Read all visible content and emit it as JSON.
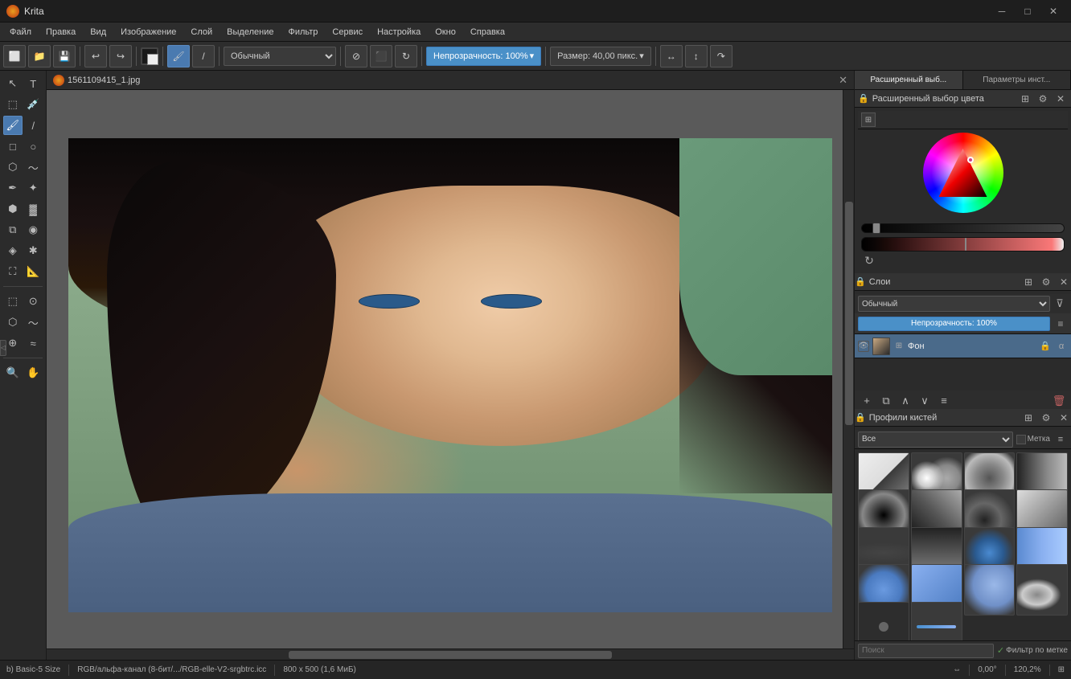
{
  "titlebar": {
    "app_name": "Krita",
    "min_label": "─",
    "max_label": "□",
    "close_label": "✕"
  },
  "menubar": {
    "items": [
      "Файл",
      "Правка",
      "Вид",
      "Изображение",
      "Слой",
      "Выделение",
      "Фильтр",
      "Сервис",
      "Настройка",
      "Окно",
      "Справка"
    ]
  },
  "toolbar": {
    "blend_mode": "Обычный",
    "opacity_label": "Непрозрачность: 100%",
    "size_label": "Размер: 40,00 пикс.",
    "undo_label": "↩",
    "redo_label": "↪"
  },
  "canvas": {
    "tab_name": "1561109415_1.jpg",
    "close_btn": "✕"
  },
  "color_panel": {
    "title": "Расширенный выбор цвета",
    "tab1": "Расширенный выб...",
    "tab2": "Параметры инст..."
  },
  "layers_panel": {
    "title": "Слои",
    "blend_mode": "Обычный",
    "opacity_label": "Непрозрачность: 100%",
    "layer_name": "Фон",
    "add_btn": "+",
    "copy_btn": "⧉",
    "up_btn": "∧",
    "down_btn": "∨",
    "merge_btn": "≡",
    "delete_btn": "🗑"
  },
  "brushes_panel": {
    "title": "Профили кистей",
    "category": "Все",
    "tag_label": "Метка",
    "search_placeholder": "Поиск",
    "filter_label": "Фильтр по метке"
  },
  "statusbar": {
    "brush_label": "b) Basic-5 Size",
    "color_mode": "RGB/альфа-канал (8-бит/.../RGB-elle-V2-srgbtrc.icc",
    "dimensions": "800 x 500 (1,6 МиБ)",
    "angle": "0,00°",
    "zoom": "120,2%",
    "screen_icon": "⊞"
  }
}
